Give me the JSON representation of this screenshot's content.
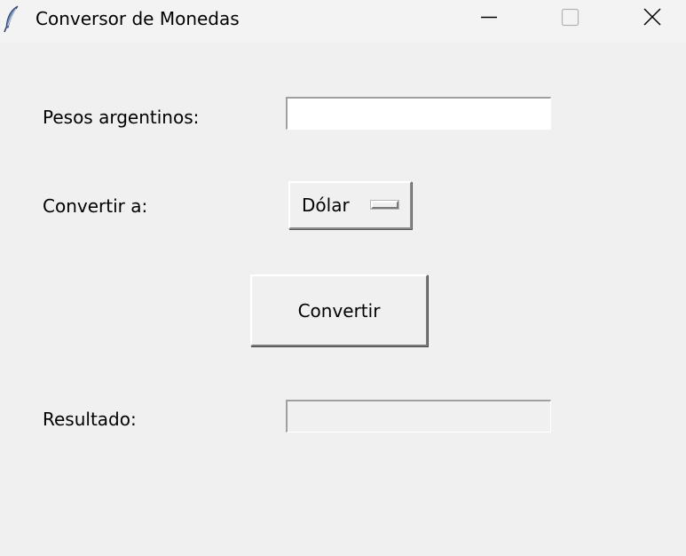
{
  "window": {
    "title": "Conversor de Monedas",
    "icon": "feather-icon"
  },
  "form": {
    "pesos_label": "Pesos argentinos:",
    "pesos_value": "",
    "convert_to_label": "Convertir a:",
    "currency_selected": "Dólar",
    "convert_button_label": "Convertir",
    "result_label": "Resultado:",
    "result_value": ""
  }
}
